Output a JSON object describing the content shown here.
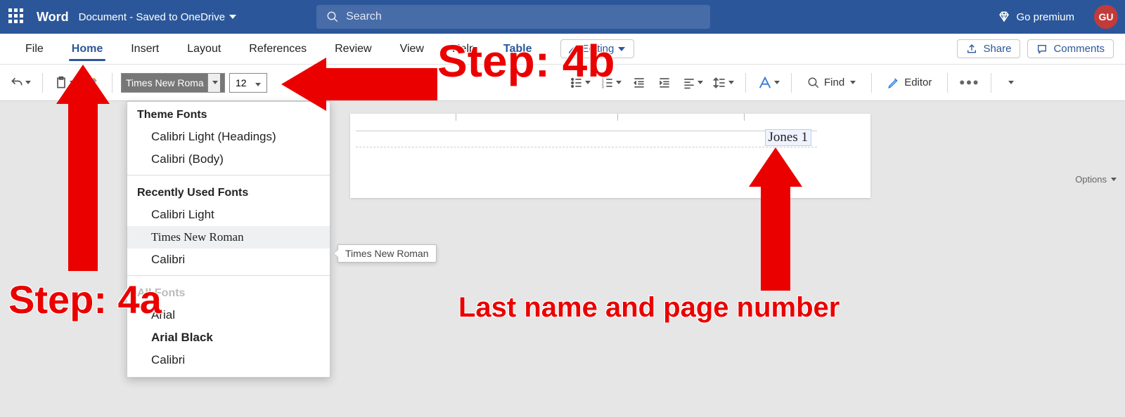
{
  "titlebar": {
    "app": "Word",
    "doc": "Document - Saved to OneDrive",
    "search_placeholder": "Search",
    "premium": "Go premium",
    "avatar": "GU"
  },
  "tabs": {
    "file": "File",
    "home": "Home",
    "insert": "Insert",
    "layout": "Layout",
    "references": "References",
    "review": "Review",
    "view": "View",
    "help": "Help",
    "table": "Table",
    "editing": "Editing",
    "share": "Share",
    "comments": "Comments"
  },
  "ribbon": {
    "font_name": "Times New Roma",
    "font_size": "12",
    "find": "Find",
    "editor": "Editor"
  },
  "font_dropdown": {
    "section_theme": "Theme Fonts",
    "theme1": "Calibri Light (Headings)",
    "theme2": "Calibri (Body)",
    "section_recent": "Recently Used Fonts",
    "r1": "Calibri Light",
    "r2": "Times New Roman",
    "r3": "Calibri",
    "section_all": "All Fonts",
    "a1": "Arial",
    "a2": "Arial Black",
    "a3": "Calibri"
  },
  "tooltip": "Times New Roman",
  "options": "Options",
  "page": {
    "header_text": "Jones 1"
  },
  "annotations": {
    "step4a": "Step: 4a",
    "step4b": "Step: 4b",
    "lastname": "Last name and page number"
  }
}
